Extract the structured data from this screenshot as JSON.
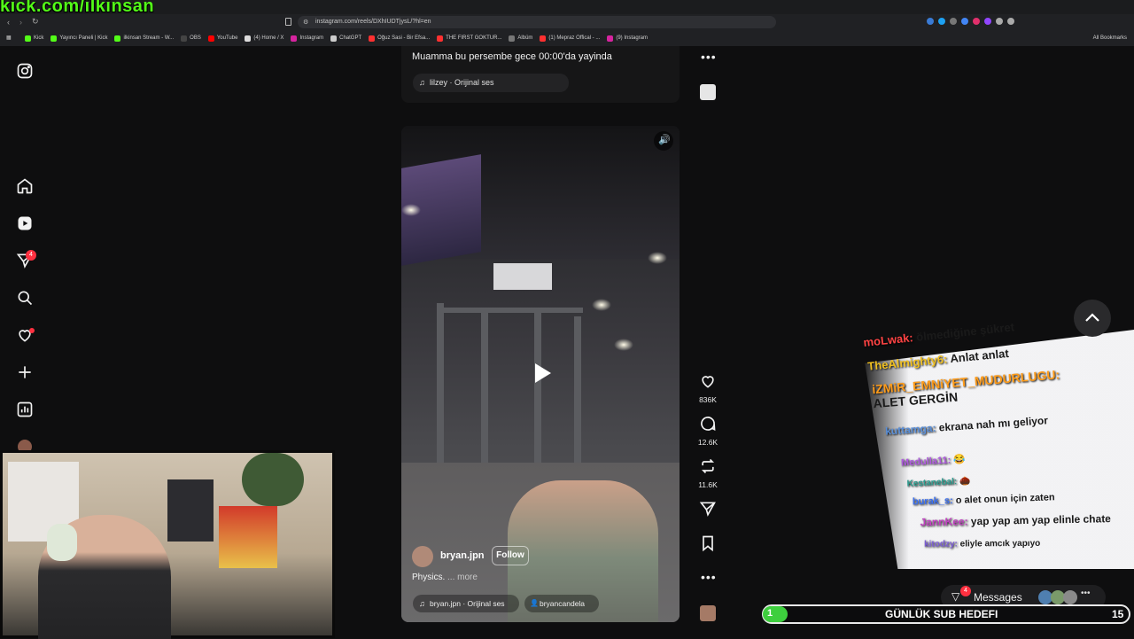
{
  "overlay": {
    "kick_url": "kick.com/ilkinsan"
  },
  "browser": {
    "url": "instagram.com/reels/DXhIUDTjysL/?hl=en",
    "bookmarks": [
      {
        "label": "Kick",
        "color": "#53fc18"
      },
      {
        "label": "Yayıncı Paneli | Kick",
        "color": "#53fc18"
      },
      {
        "label": "ilkinsan Stream - W...",
        "color": "#53fc18"
      },
      {
        "label": "OBS",
        "color": "#444444"
      },
      {
        "label": "YouTube",
        "color": "#ff0000"
      },
      {
        "label": "(4) Home / X",
        "color": "#dddddd"
      },
      {
        "label": "Instagram",
        "color": "#d6249f"
      },
      {
        "label": "ChatGPT",
        "color": "#cccccc"
      },
      {
        "label": "Oğuz Sasi - Bir Efsa...",
        "color": "#ff3030"
      },
      {
        "label": "THE FIRST GOKTUR...",
        "color": "#ff3030"
      },
      {
        "label": "Albüm",
        "color": "#777777"
      },
      {
        "label": "(1) Mepraz Offical - ...",
        "color": "#ff3030"
      },
      {
        "label": "(9) Instagram",
        "color": "#d6249f"
      }
    ],
    "all_bookmarks": "All Bookmarks"
  },
  "sidebar": {
    "notification_count": "4"
  },
  "previous_reel": {
    "caption": "Muamma bu persembe gece 00:00'da yayinda",
    "audio": "lilzey · Orijinal ses"
  },
  "reel": {
    "username": "bryan.jpn",
    "follow_label": "Follow",
    "caption": "Physics.",
    "more_label": "... more",
    "audio": "bryan.jpn · Orijinal ses",
    "tagged_user": "bryancandela",
    "likes": "836K",
    "comments": "12.6K",
    "reposts": "11.6K"
  },
  "chat": [
    {
      "user": "moLwak:",
      "text": "ölmediğine şükret",
      "color": "#ff4444"
    },
    {
      "user": "TheAlmighty6:",
      "text": "Anlat anlat",
      "color": "#f0c020"
    },
    {
      "user": "iZMiR_EMNiYET_MUDURLUGU:",
      "text": "ALET GERGİN",
      "color": "#ff9c1a"
    },
    {
      "user": "kuttamga:",
      "text": "ekrana nah mı geliyor",
      "color": "#5a8fd8"
    },
    {
      "user": "Medulla11:",
      "text": "😂",
      "color": "#b05ae0"
    },
    {
      "user": "Kestanebal:",
      "text": "🌰",
      "color": "#2a9d8f"
    },
    {
      "user": "burak_s:",
      "text": "o alet onun için zaten",
      "color": "#3a6ff0"
    },
    {
      "user": "JannKee:",
      "text": "yap yap am yap elinle chate",
      "color": "#c040c0"
    },
    {
      "user": "kitodzy:",
      "text": "eliyle amcık yapıyo",
      "color": "#7b5cd6"
    }
  ],
  "messages": {
    "label": "Messages",
    "badge": "4"
  },
  "sub_goal": {
    "start": "1",
    "label": "GÜNLÜK SUB HEDEFI",
    "end": "15",
    "progress": 0.067
  }
}
